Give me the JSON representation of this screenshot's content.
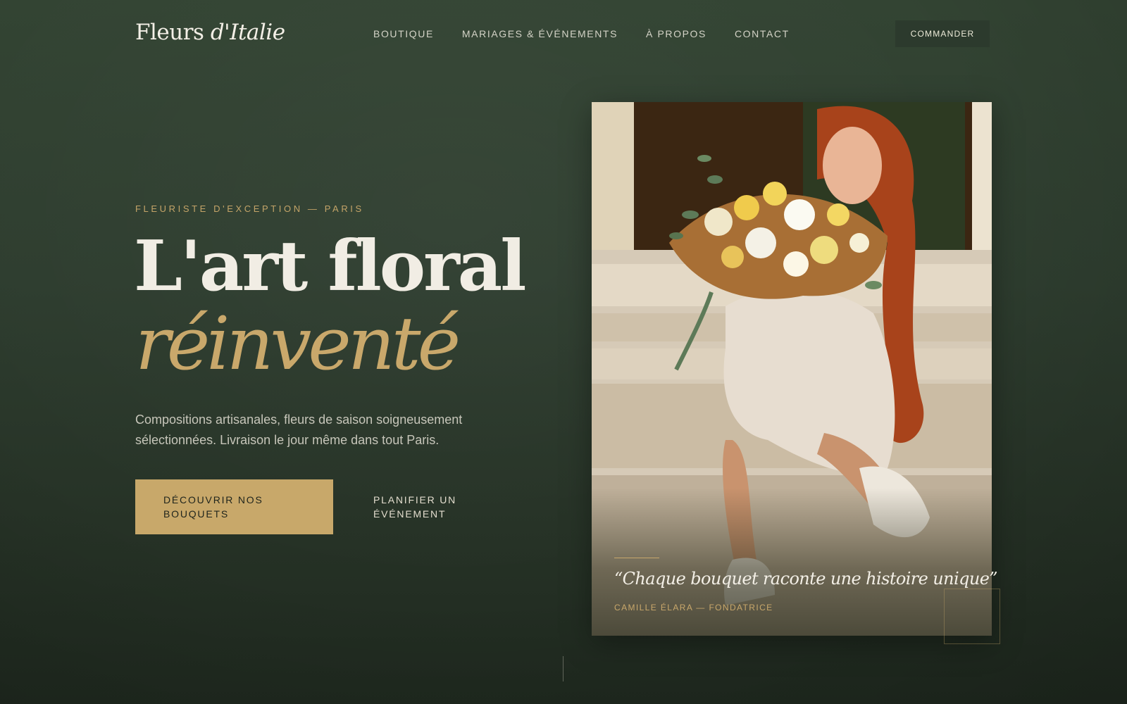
{
  "brand": {
    "logo_main": "Fleurs ",
    "logo_italic": "d'Italie"
  },
  "nav": {
    "links": [
      "BOUTIQUE",
      "MARIAGES & ÉVÉNEMENTS",
      "À PROPOS",
      "CONTACT"
    ],
    "cta_label": "COMMANDER"
  },
  "hero": {
    "eyebrow": "FLEURISTE D'EXCEPTION — PARIS",
    "headline_line1": "L'art floral",
    "headline_line2": "réinventé",
    "lede": "Compositions artisanales, fleurs de saison soigneusement sélectionnées. Livraison le jour même dans tout Paris.",
    "primary_button": "DÉCOUVRIR NOS BOUQUETS",
    "secondary_button": "PLANIFIER UN ÉVÉNEMENT"
  },
  "photo_card": {
    "quote": "“Chaque bouquet raconte une histoire unique”",
    "author": "CAMILLE ÉLARA — FONDATRICE"
  },
  "colors": {
    "background": "#2e3d2f",
    "accent_gold": "#c8a86a",
    "text_light": "#f1ede4",
    "text_muted": "#c7c6ba"
  }
}
